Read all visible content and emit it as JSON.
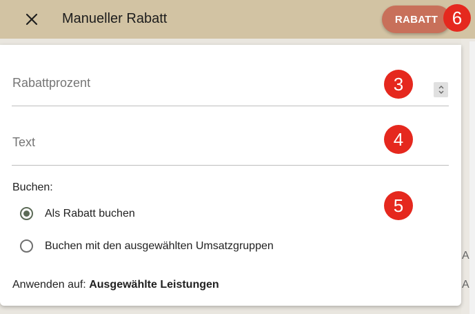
{
  "header": {
    "title": "Manueller Rabatt",
    "action_label": "RABATT",
    "close_icon": "close-icon",
    "color": "#d2c3a3",
    "action_color": "#c8705a"
  },
  "annotations": {
    "badge_3": "3",
    "badge_4": "4",
    "badge_5": "5",
    "badge_6": "6",
    "color": "#e5281e"
  },
  "form": {
    "percent_label": "Rabattprozent",
    "percent_value": "",
    "text_label": "Text",
    "text_value": "",
    "buchen_label": "Buchen:",
    "options": [
      {
        "label": "Als Rabatt buchen",
        "selected": true
      },
      {
        "label": "Buchen mit den ausgewählten Umsatzgruppen",
        "selected": false
      }
    ],
    "apply_prefix": "Anwenden auf:",
    "apply_value": "Ausgewählte Leistungen"
  },
  "background": {
    "mark_a": "A",
    "mark_b": "A"
  }
}
